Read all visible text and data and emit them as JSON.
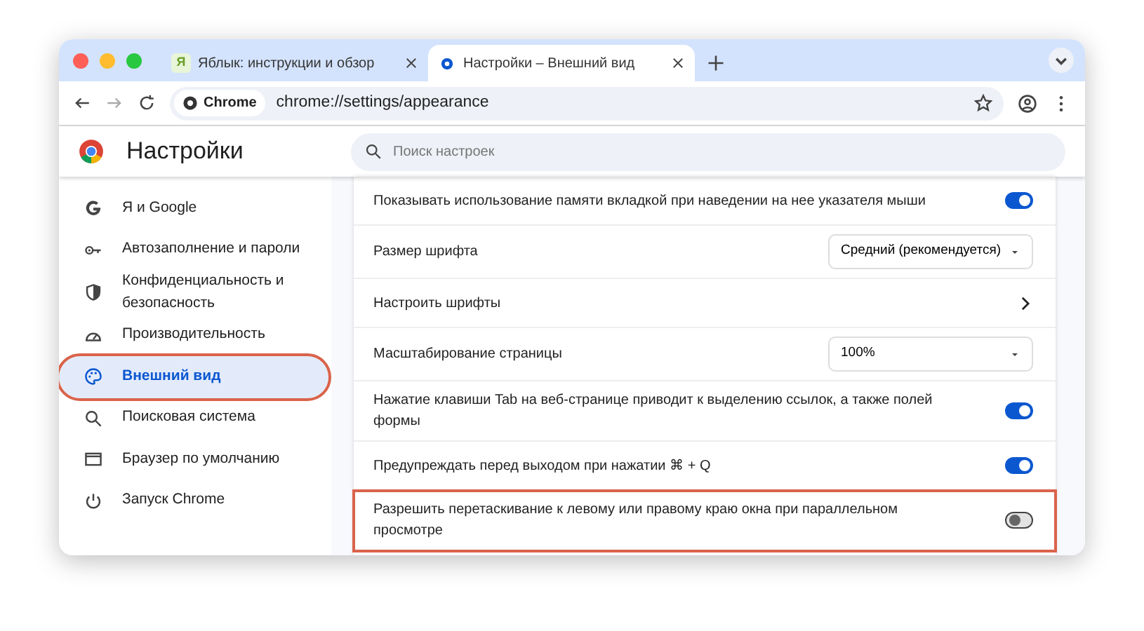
{
  "tabs": [
    {
      "title": "Яблык: инструкции и обзор",
      "favicon": "Я",
      "selected": false
    },
    {
      "title": "Настройки – Внешний вид",
      "selected": true
    }
  ],
  "toolbar": {
    "chip": "Chrome",
    "url": "chrome://settings/appearance"
  },
  "header": {
    "title": "Настройки",
    "search_placeholder": "Поиск настроек"
  },
  "sidebar": {
    "items": [
      {
        "label": "Я и Google",
        "selected": false,
        "highlighted": false
      },
      {
        "label": "Автозаполнение и пароли",
        "selected": false,
        "highlighted": false
      },
      {
        "label": "Конфиденциальность и безопасность",
        "selected": false,
        "highlighted": false
      },
      {
        "label": "Производительность",
        "selected": false,
        "highlighted": false
      },
      {
        "label": "Внешний вид",
        "selected": true,
        "highlighted": true
      },
      {
        "label": "Поисковая система",
        "selected": false,
        "highlighted": false
      },
      {
        "label": "Браузер по умолчанию",
        "selected": false,
        "highlighted": false
      },
      {
        "label": "Запуск Chrome",
        "selected": false,
        "highlighted": false
      }
    ]
  },
  "settings": [
    {
      "kind": "toggle",
      "label": "Показывать использование памяти вкладкой при наведении на нее указателя мыши",
      "on": true,
      "highlighted": false
    },
    {
      "kind": "select",
      "label": "Размер шрифта",
      "value": "Средний (рекомендуется)",
      "highlighted": false
    },
    {
      "kind": "link",
      "label": "Настроить шрифты",
      "highlighted": false
    },
    {
      "kind": "select",
      "label": "Масштабирование страницы",
      "value": "100%",
      "highlighted": false
    },
    {
      "kind": "toggle",
      "label": "Нажатие клавиши Tab на веб-странице приводит к выделению ссылок, а также полей формы",
      "on": true,
      "highlighted": false
    },
    {
      "kind": "toggle",
      "label": "Предупреждать перед выходом при нажатии ⌘ + Q",
      "on": true,
      "highlighted": false
    },
    {
      "kind": "toggle",
      "label": "Разрешить перетаскивание к левому или правому краю окна при параллельном просмотре",
      "on": false,
      "highlighted": true
    }
  ]
}
